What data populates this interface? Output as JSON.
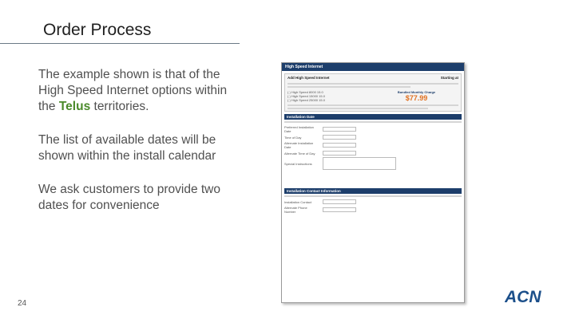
{
  "slide": {
    "title": "Order Process",
    "bullet1_pre": "The example shown is that of the High Speed Internet options within the ",
    "bullet1_highlight": "Telus",
    "bullet1_post": " territories.",
    "bullet2": "The list of available dates will be shown within the install calendar",
    "bullet3": "We ask customers to provide two dates for convenience",
    "page_number": "24",
    "logo_text": "ACN",
    "colors": {
      "accent": "#4a8a2a",
      "logo_blue": "#1b4f8a",
      "rule": "#6a7a86"
    }
  },
  "screenshot": {
    "header": "High Speed Internet",
    "pane_title": "Add High Speed Internet",
    "starting_at": "Starting at",
    "price": "$77.99",
    "bundled": "Bundled Monthly Charge",
    "speed_options": [
      "High Speed 8000 15.0",
      "High Speed 15000 15.0",
      "High Speed 25000 15.0"
    ],
    "installation_section": "Installation Date",
    "fields": [
      "Preferred Installation Date",
      "Time of Day",
      "Alternate Installation Date",
      "Alternate Time of Day",
      "Special Instructions"
    ],
    "contact_section": "Installation Contact Information",
    "contact_fields": [
      "Installation Contact",
      "Alternate Phone Number"
    ]
  }
}
